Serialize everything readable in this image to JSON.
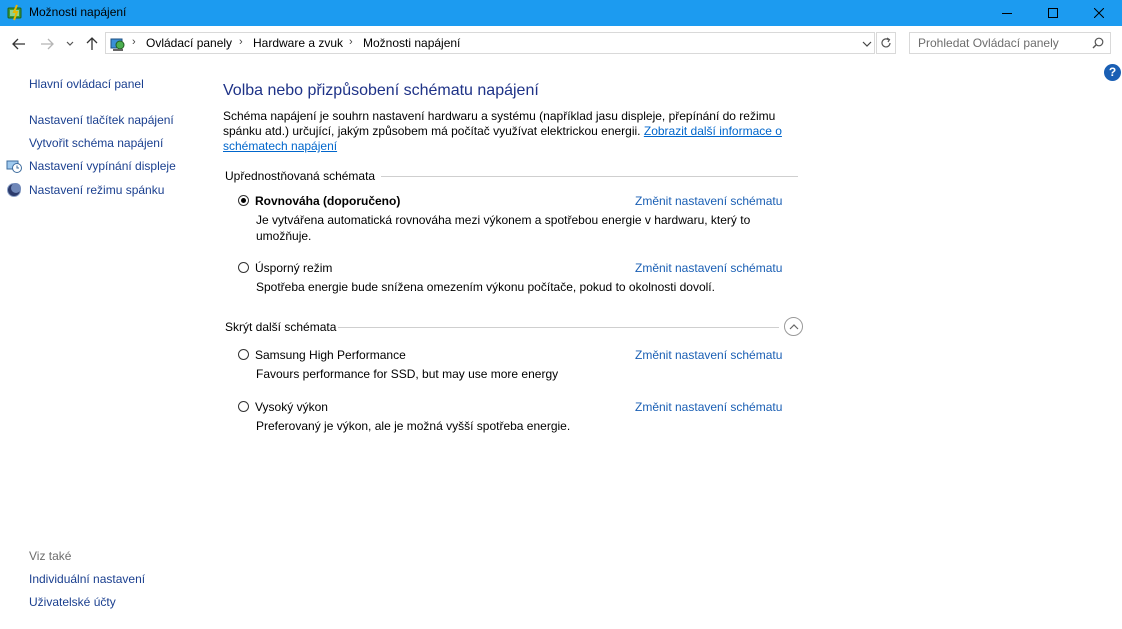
{
  "window": {
    "title": "Možnosti napájení",
    "app_icon": "power-options-icon",
    "controls": [
      "minimize-icon",
      "maximize-icon",
      "close-icon"
    ]
  },
  "nav": {
    "breadcrumb": [
      "Ovládací panely",
      "Hardware a zvuk",
      "Možnosti napájení"
    ],
    "search_placeholder": "Prohledat Ovládací panely"
  },
  "sidebar": {
    "home_link": "Hlavní ovládací panel",
    "links": [
      {
        "label": "Nastavení tlačítek napájení",
        "icon": ""
      },
      {
        "label": "Vytvořit schéma napájení",
        "icon": ""
      },
      {
        "label": "Nastavení vypínání displeje",
        "icon": "display-clock-icon"
      },
      {
        "label": "Nastavení režimu spánku",
        "icon": "moon-icon"
      }
    ],
    "see_also": "Viz také",
    "see_also_links": [
      "Individuální nastavení",
      "Uživatelské účty"
    ]
  },
  "main": {
    "heading": "Volba nebo přizpůsobení schématu napájení",
    "description": "Schéma napájení je souhrn nastavení hardwaru a systému (například jasu displeje, přepínání do režimu spánku atd.) určující, jakým způsobem má počítač využívat elektrickou energii.",
    "description_link": "Zobrazit další informace o schématech napájení",
    "preferred_title": "Upřednostňovaná schémata",
    "hidden_title": "Skrýt další schémata",
    "change_label": "Změnit nastavení schématu",
    "preferred_plans": [
      {
        "name": "Rovnováha (doporučeno)",
        "desc": "Je vytvářena automatická rovnováha mezi výkonem a spotřebou energie v hardwaru, který to umožňuje.",
        "selected": true
      },
      {
        "name": "Úsporný režim",
        "desc": "Spotřeba energie bude snížena omezením výkonu počítače, pokud to okolnosti dovolí.",
        "selected": false
      }
    ],
    "hidden_plans": [
      {
        "name": "Samsung High Performance",
        "desc": "Favours performance for SSD, but may use more energy",
        "selected": false
      },
      {
        "name": "Vysoký výkon",
        "desc": "Preferovaný je výkon, ale je možná vyšší spotřeba energie.",
        "selected": false
      }
    ]
  },
  "colors": {
    "titlebar": "#1c9bf0",
    "link": "#1a5fb4",
    "heading": "#1e3287"
  }
}
